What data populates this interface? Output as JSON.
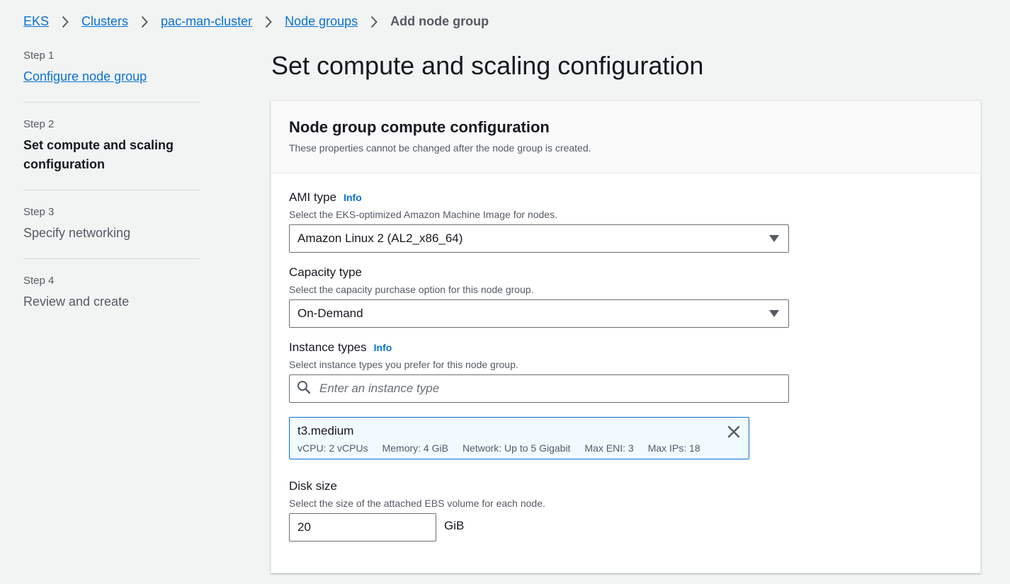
{
  "breadcrumb": {
    "items": [
      "EKS",
      "Clusters",
      "pac-man-cluster",
      "Node groups"
    ],
    "current": "Add node group"
  },
  "steps": [
    {
      "num": "Step 1",
      "title": "Configure node group",
      "state": "link"
    },
    {
      "num": "Step 2",
      "title": "Set compute and scaling configuration",
      "state": "active"
    },
    {
      "num": "Step 3",
      "title": "Specify networking",
      "state": "disabled"
    },
    {
      "num": "Step 4",
      "title": "Review and create",
      "state": "disabled"
    }
  ],
  "page_title": "Set compute and scaling configuration",
  "panel": {
    "title": "Node group compute configuration",
    "subtitle": "These properties cannot be changed after the node group is created."
  },
  "ami_type": {
    "label": "AMI type",
    "info": "Info",
    "description": "Select the EKS-optimized Amazon Machine Image for nodes.",
    "value": "Amazon Linux 2 (AL2_x86_64)"
  },
  "capacity_type": {
    "label": "Capacity type",
    "description": "Select the capacity purchase option for this node group.",
    "value": "On-Demand"
  },
  "instance_types": {
    "label": "Instance types",
    "info": "Info",
    "description": "Select instance types you prefer for this node group.",
    "placeholder": "Enter an instance type",
    "selected": {
      "name": "t3.medium",
      "vcpu": "vCPU: 2 vCPUs",
      "memory": "Memory: 4 GiB",
      "network": "Network: Up to 5 Gigabit",
      "max_eni": "Max ENI: 3",
      "max_ips": "Max IPs: 18"
    }
  },
  "disk_size": {
    "label": "Disk size",
    "description": "Select the size of the attached EBS volume for each node.",
    "value": "20",
    "unit": "GiB"
  },
  "colors": {
    "link": "#0972d3",
    "text": "#16191f",
    "muted": "#545b64",
    "background": "#f2f3f3",
    "token_bg": "#f1faff"
  },
  "icons": {
    "breadcrumb_separator": "chevron-right-icon",
    "dropdown": "caret-down-icon",
    "search": "search-icon",
    "remove": "close-icon"
  }
}
